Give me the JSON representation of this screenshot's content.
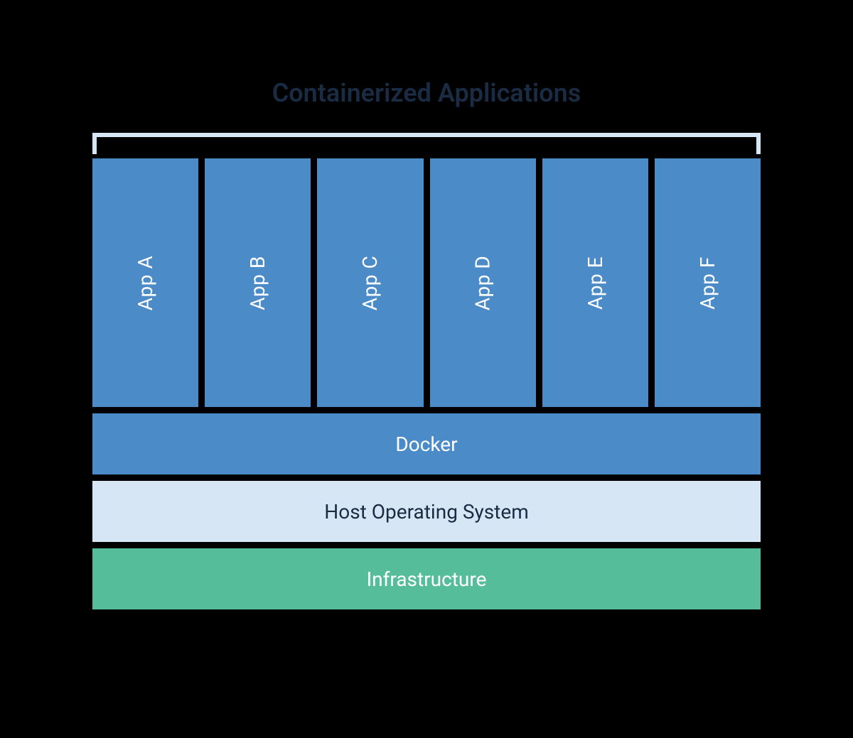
{
  "title": "Containerized Applications",
  "apps": {
    "items": [
      {
        "label": "App A"
      },
      {
        "label": "App B"
      },
      {
        "label": "App C"
      },
      {
        "label": "App D"
      },
      {
        "label": "App E"
      },
      {
        "label": "App F"
      }
    ]
  },
  "layers": {
    "docker": "Docker",
    "host": "Host Operating System",
    "infra": "Infrastructure"
  },
  "colors": {
    "app_box": "#4b8bc8",
    "docker": "#4b8bc8",
    "host_bg": "#d7e6f5",
    "host_text": "#1a2b44",
    "infra": "#56bd9a",
    "title": "#1a2b44",
    "bracket": "#d7e6f5",
    "background": "#000000"
  }
}
